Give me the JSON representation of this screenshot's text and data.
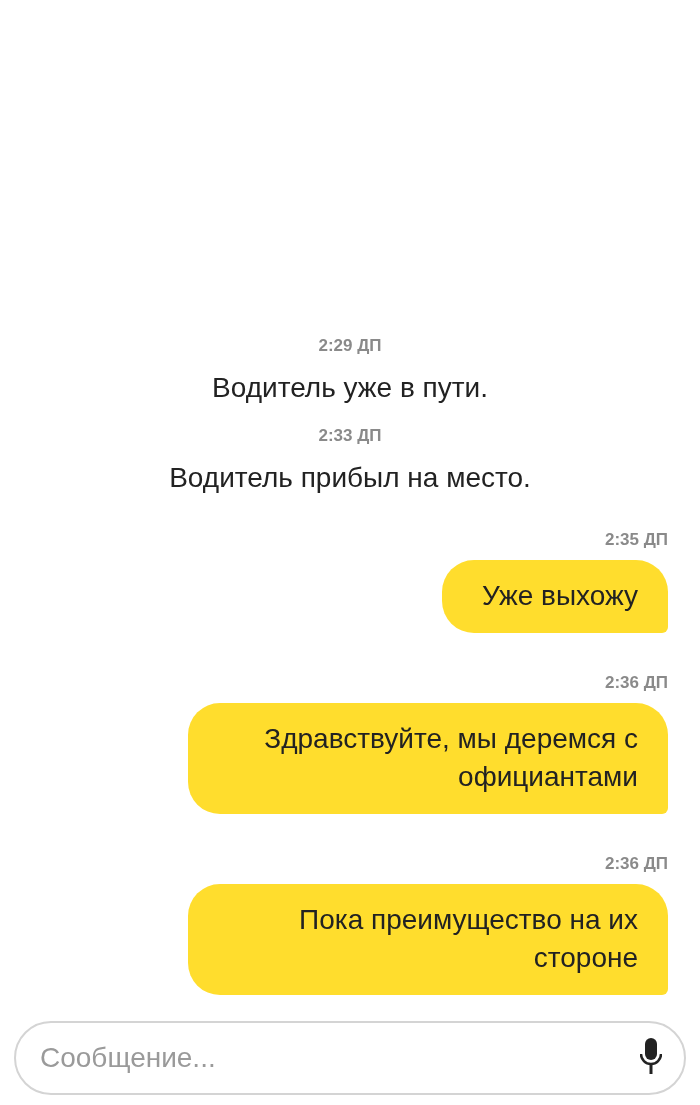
{
  "messages": [
    {
      "kind": "system",
      "time": "2:29 ДП",
      "text": "Водитель уже в пути."
    },
    {
      "kind": "system",
      "time": "2:33 ДП",
      "text": "Водитель прибыл на место."
    },
    {
      "kind": "outgoing",
      "time": "2:35 ДП",
      "text": "Уже выхожу"
    },
    {
      "kind": "outgoing",
      "time": "2:36 ДП",
      "text": "Здравствуйте, мы деремся с официантами"
    },
    {
      "kind": "outgoing",
      "time": "2:36 ДП",
      "text": "Пока преимущество на их стороне"
    }
  ],
  "composer": {
    "placeholder": "Сообщение..."
  }
}
